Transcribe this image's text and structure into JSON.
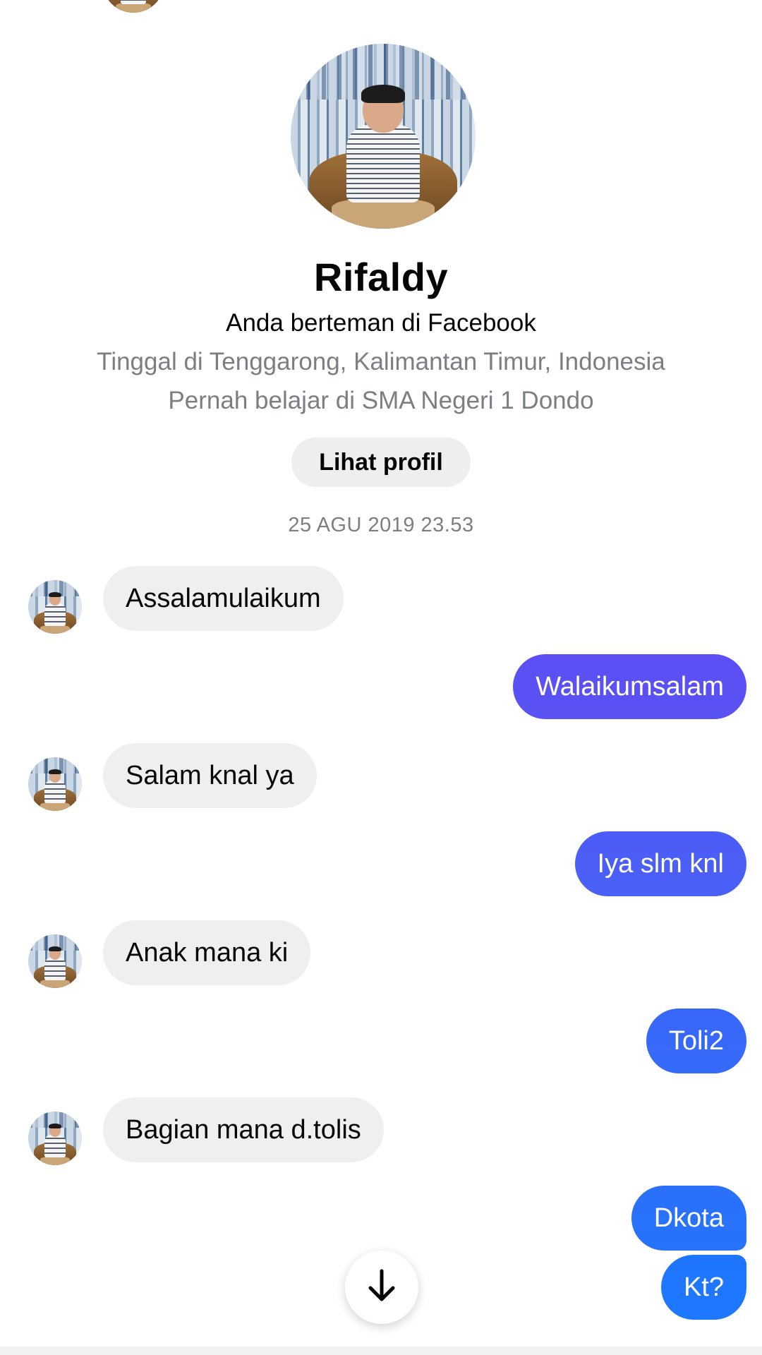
{
  "profile": {
    "name": "Rifaldy",
    "relationship": "Anda berteman di Facebook",
    "lives_in": "Tinggal di Tenggarong, Kalimantan Timur, Indonesia",
    "studied_at": "Pernah belajar di SMA Negeri 1 Dondo",
    "view_profile_label": "Lihat profil"
  },
  "conversation": {
    "timestamp": "25 AGU 2019 23.53",
    "messages": [
      {
        "direction": "in",
        "text": "Assalamulaikum"
      },
      {
        "direction": "out",
        "text": "Walaikumsalam"
      },
      {
        "direction": "in",
        "text": "Salam knal ya"
      },
      {
        "direction": "out",
        "text": "Iya slm knl"
      },
      {
        "direction": "in",
        "text": "Anak mana ki"
      },
      {
        "direction": "out",
        "text": "Toli2"
      },
      {
        "direction": "in",
        "text": "Bagian mana d.tolis"
      },
      {
        "direction": "out",
        "text": "Dkota"
      },
      {
        "direction": "out",
        "text": "Kt?"
      }
    ]
  },
  "controls": {
    "scroll_down_icon": "arrow-down-icon"
  },
  "colors": {
    "incoming_bubble": "#efeff0",
    "outgoing_gradient_top": "#5b4ff5",
    "outgoing_gradient_bottom": "#1e76ff",
    "secondary_text": "#7b7e82"
  }
}
